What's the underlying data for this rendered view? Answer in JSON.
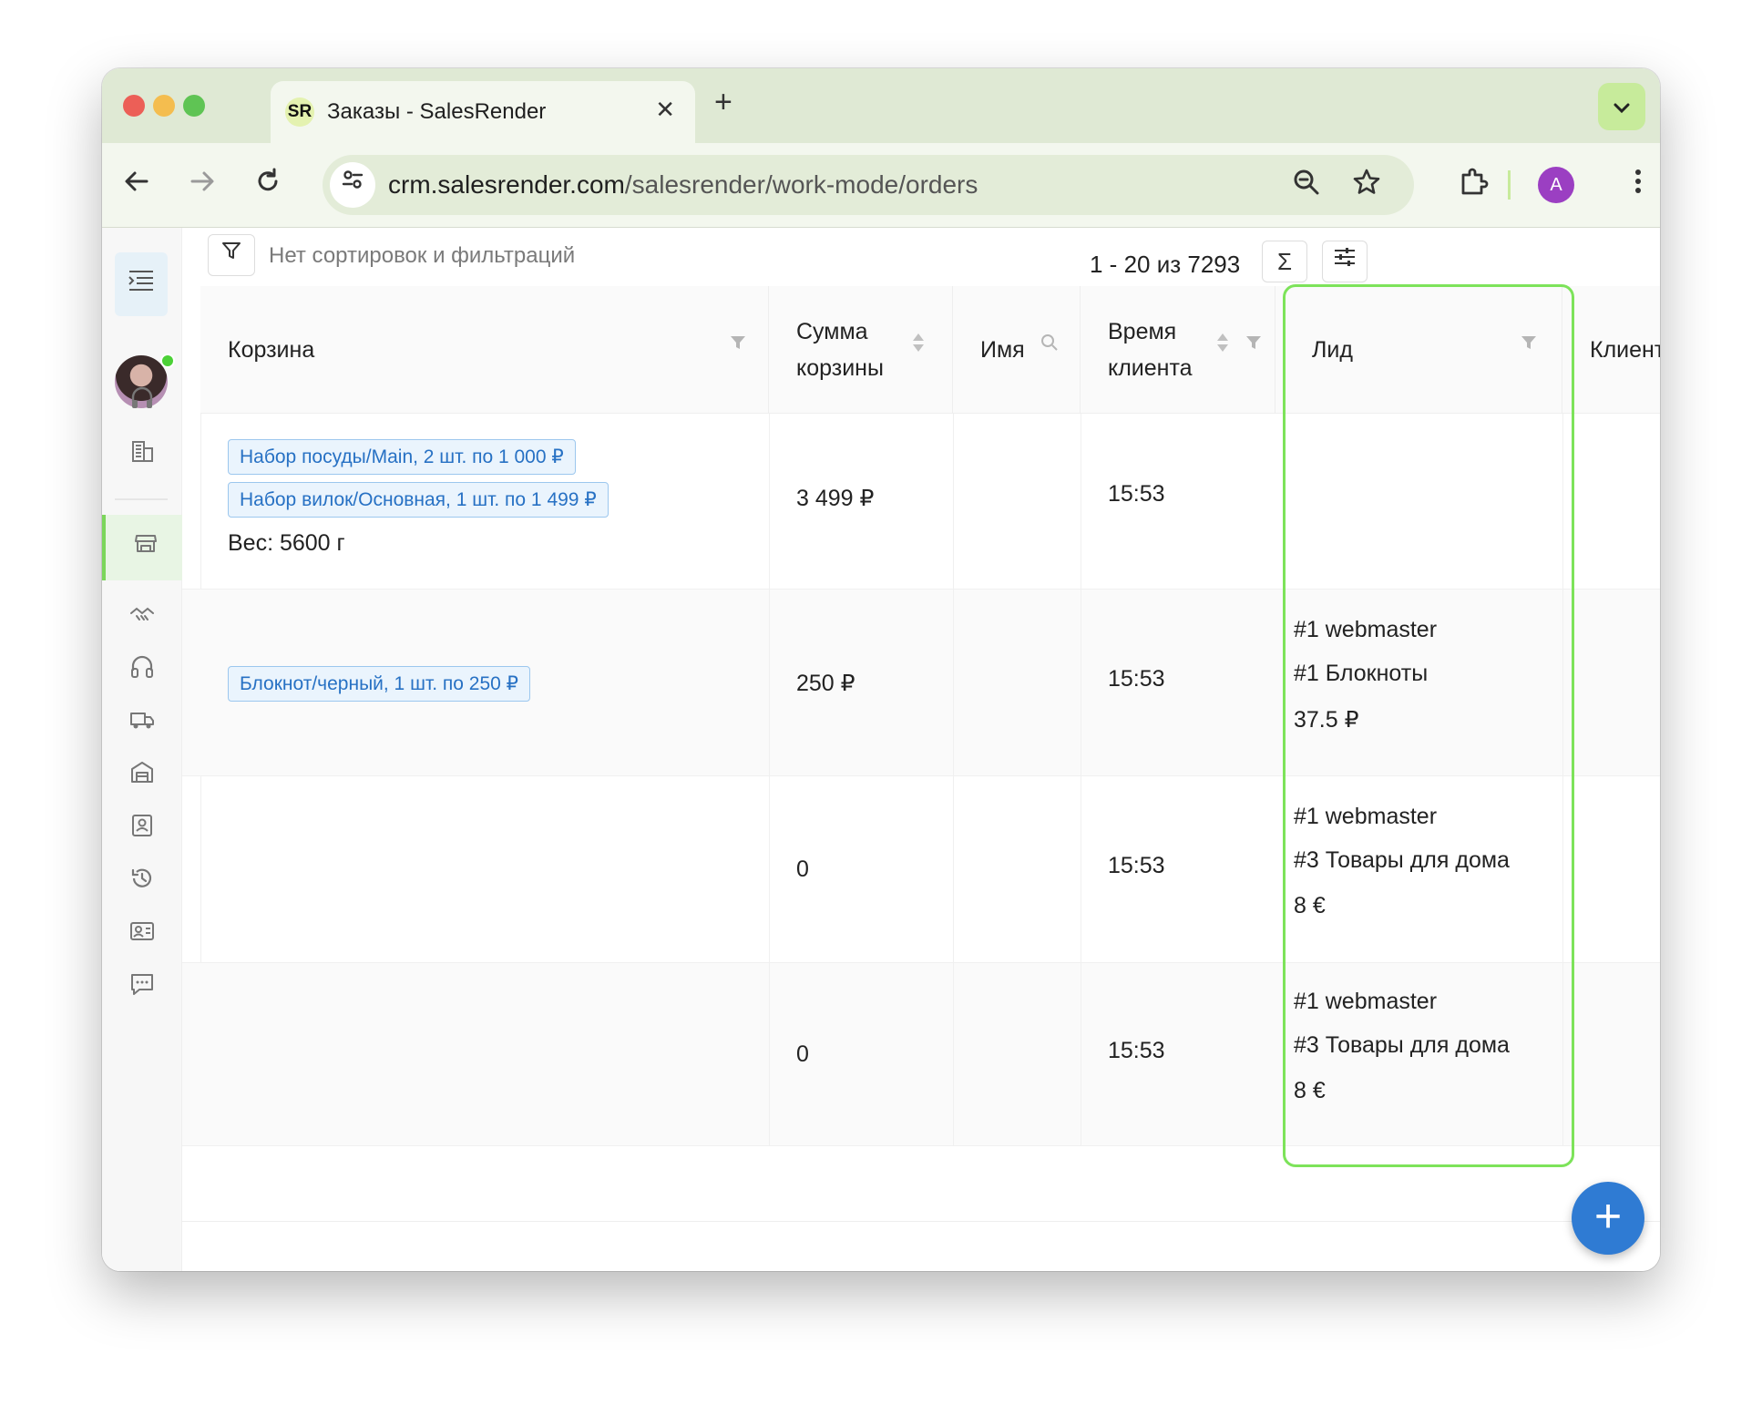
{
  "browser": {
    "tab_title": "Заказы - SalesRender",
    "tab_logo": "SR",
    "tab_close": "✕",
    "new_tab": "+",
    "url_host": "crm.salesrender.com",
    "url_path": "/salesrender/work-mode/orders",
    "profile_initial": "A"
  },
  "filter": {
    "text": "Нет сортировок и фильтраций",
    "pager": "1 - 20 из 7293",
    "sum_icon": "Σ"
  },
  "columns": [
    {
      "label": "Корзина"
    },
    {
      "label_l1": "Сумма",
      "label_l2": "корзины"
    },
    {
      "label": "Имя"
    },
    {
      "label_l1": "Время",
      "label_l2": "клиента"
    },
    {
      "label": "Лид"
    },
    {
      "label": "Клиент"
    }
  ],
  "rows": [
    {
      "cart_items": [
        "Набор посуды/Main, 2 шт. по 1 000 ₽",
        "Набор вилок/Основная, 1 шт. по 1 499 ₽"
      ],
      "cart_weight": "Вес: 5600 г",
      "sum": "3 499 ₽",
      "time": "15:53",
      "lead": [
        "",
        "",
        ""
      ]
    },
    {
      "cart_items": [
        "Блокнот/черный, 1 шт. по 250 ₽"
      ],
      "cart_weight": "",
      "sum": "250 ₽",
      "time": "15:53",
      "lead": [
        "#1 webmaster",
        "#1 Блокноты",
        "37.5 ₽"
      ]
    },
    {
      "cart_items": [],
      "cart_weight": "",
      "sum": "0",
      "time": "15:53",
      "lead": [
        "#1 webmaster",
        "#3 Товары для дома",
        "8 €"
      ]
    },
    {
      "cart_items": [],
      "cart_weight": "",
      "sum": "0",
      "time": "15:53",
      "lead": [
        "#1 webmaster",
        "#3 Товары для дома",
        "8 €"
      ]
    }
  ],
  "fab_label": "+",
  "colors": {
    "accent_green": "#7de35a",
    "chip_blue": "#2771c4",
    "fab_blue": "#2f7bd3"
  }
}
